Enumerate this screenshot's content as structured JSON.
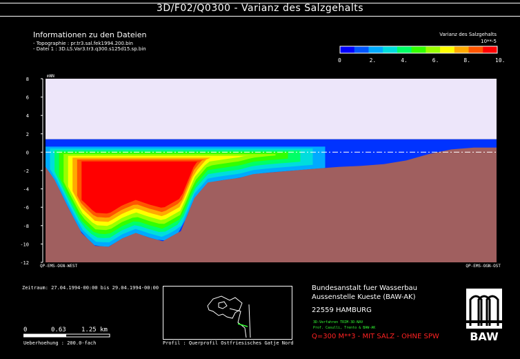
{
  "header": {
    "title": "3D/F02/Q0300 - Varianz des Salzgehalts"
  },
  "info": {
    "heading": "Informationen zu den Dateien",
    "topographie": "- Topographie : pr.tr3.sal.fek1994.200.bin",
    "datei": "- Datei 1 : 3D.LS.Var3.tr3.q300.s125d15.sp.bin"
  },
  "legend": {
    "title": "Varianz des Salzgehalts",
    "unit": "10**-5",
    "ticks": [
      "0",
      "2.",
      "4.",
      "6.",
      "8.",
      "10."
    ],
    "min": 0,
    "max": 10,
    "colors": [
      "#0000ff",
      "#0055ff",
      "#00aaff",
      "#00dddd",
      "#00ff66",
      "#33ff00",
      "#99ff00",
      "#ffff00",
      "#ffaa00",
      "#ff5500",
      "#ff0000"
    ]
  },
  "chart_data": {
    "type": "area",
    "ylabel": "mNN",
    "ylim": [
      -12,
      8
    ],
    "y_ticks": [
      "8",
      "6",
      "4",
      "2",
      "0",
      "-2",
      "-4",
      "-6",
      "-8",
      "-10",
      "-12"
    ],
    "x_left_label": "QP-EMS-OGN-WEST",
    "x_right_label": "QP-EMS-OGN-OST",
    "water_level": 0,
    "water_surface": 1.4,
    "bathymetry": {
      "x": [
        0,
        0.02,
        0.05,
        0.08,
        0.11,
        0.14,
        0.17,
        0.2,
        0.23,
        0.26,
        0.3,
        0.33,
        0.36,
        0.4,
        0.43,
        0.46,
        0.5,
        0.55,
        0.6,
        0.65,
        0.7,
        0.75,
        0.8,
        0.85,
        0.9,
        0.95,
        1.0
      ],
      "y": [
        -1.6,
        -3.0,
        -6.0,
        -8.8,
        -10.2,
        -10.3,
        -9.4,
        -8.8,
        -9.3,
        -9.7,
        -8.6,
        -5.0,
        -3.3,
        -3.0,
        -2.8,
        -2.4,
        -2.2,
        -2.0,
        -1.8,
        -1.6,
        -1.5,
        -1.3,
        -0.9,
        -0.2,
        0.3,
        0.5,
        0.5
      ],
      "color": "#a05f5f"
    },
    "variance_zones": [
      {
        "level": 1,
        "color": "#00aaff"
      },
      {
        "level": 2,
        "color": "#00dddd"
      },
      {
        "level": 3,
        "color": "#00ff66"
      },
      {
        "level": 4,
        "color": "#33ff00"
      },
      {
        "level": 6,
        "color": "#99ff00"
      },
      {
        "level": 7,
        "color": "#ffff00"
      },
      {
        "level": 8,
        "color": "#ffaa00"
      },
      {
        "level": 9,
        "color": "#ff5500"
      },
      {
        "level": 10,
        "color": "#ff0000"
      }
    ],
    "air_color": "#ede6fa",
    "water_base_color": "#0033ff"
  },
  "meta": {
    "zeitraum": "Zeitraum: 27.04.1994-00:00 bis 29.04.1994-00:00",
    "scale": [
      "0",
      "0.63",
      "1.25 km"
    ],
    "ueberhoehung": "Ueberhoehung : 200.0-fach",
    "profil": "Profil : Querprofil Ostfriesisches Gatje Nord"
  },
  "institution": {
    "line1": "Bundesanstalt fuer Wasserbau",
    "line2": "Aussenstelle Kueste (BAW-AK)",
    "city": "22559 HAMBURG",
    "note1": "3D-Verfahren TRIM-3D-NAV",
    "note2": "Prof. Casulli, Trento & BAW-AK",
    "case": "Q=300 M**3 - MIT SALZ - OHNE SPW",
    "logo": "BAW"
  }
}
